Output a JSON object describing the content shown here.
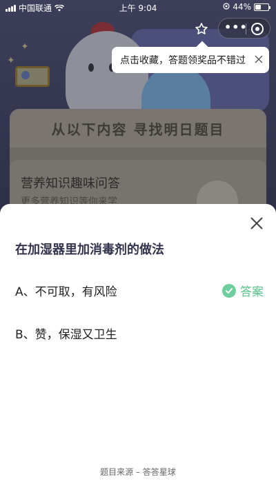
{
  "status_bar": {
    "carrier": "中国联通",
    "time": "上午 9:04",
    "battery": "44%",
    "battery_level": 0.44
  },
  "tooltip": {
    "text": "点击收藏，答题领奖品不错过"
  },
  "background": {
    "card_title": "从以下内容  寻找明日题目",
    "sub_title": "营养知识趣味问答",
    "sub_text": "更多营养知识等你来学"
  },
  "sheet": {
    "question": "在加湿器里加消毒剂的做法",
    "options": [
      {
        "label": "A、不可取，有风险",
        "is_answer": true
      },
      {
        "label": "B、赞，保湿又卫生",
        "is_answer": false
      }
    ],
    "answer_label": "答案",
    "source": "题目来源 – 答答星球"
  },
  "colors": {
    "answer_green": "#58c48c",
    "question_text": "#33334d"
  },
  "icons": [
    "star-icon",
    "more-icon",
    "exit-icon",
    "close-icon",
    "check-icon",
    "wifi-icon",
    "location-icon"
  ]
}
